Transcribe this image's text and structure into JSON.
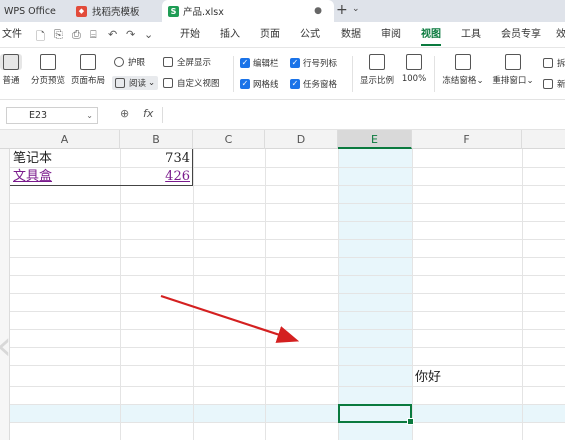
{
  "tabs": {
    "app": "WPS Office",
    "templates": "找稻壳模板",
    "file": "产品.xlsx"
  },
  "menu": {
    "file": "文件",
    "items": [
      "开始",
      "插入",
      "页面",
      "公式",
      "数据",
      "审阅",
      "视图",
      "工具",
      "会员专享",
      "效"
    ],
    "active": "视图"
  },
  "ribbon": {
    "normal": "普通",
    "page_break_preview": "分页预览",
    "page_layout": "页面布局",
    "eye_protect": "护眼",
    "reading": "阅读",
    "full_screen": "全屏显示",
    "custom_view": "自定义视图",
    "edit_bar": "编辑栏",
    "gridlines": "网格线",
    "row_col_headers": "行号列标",
    "task_pane": "任务窗格",
    "zoom_label": "显示比例",
    "zoom_value": "100%",
    "freeze_panes": "冻结窗格",
    "rearrange": "重排窗口",
    "split": "拆",
    "new_window": "新"
  },
  "formula_bar": {
    "name_box": "E23",
    "fx": "fx",
    "formula": ""
  },
  "sheet": {
    "columns": [
      "A",
      "B",
      "C",
      "D",
      "E",
      "F"
    ],
    "selected_column": "E",
    "cells": {
      "a1": "笔记本",
      "b1": "734",
      "a2": "文具盒",
      "b2": "426",
      "f_hello": "你好"
    }
  },
  "colors": {
    "accent": "#0a7a3e",
    "selection_band": "#e8f6fb",
    "arrow": "#d42020",
    "link": "#7a1a8c"
  }
}
